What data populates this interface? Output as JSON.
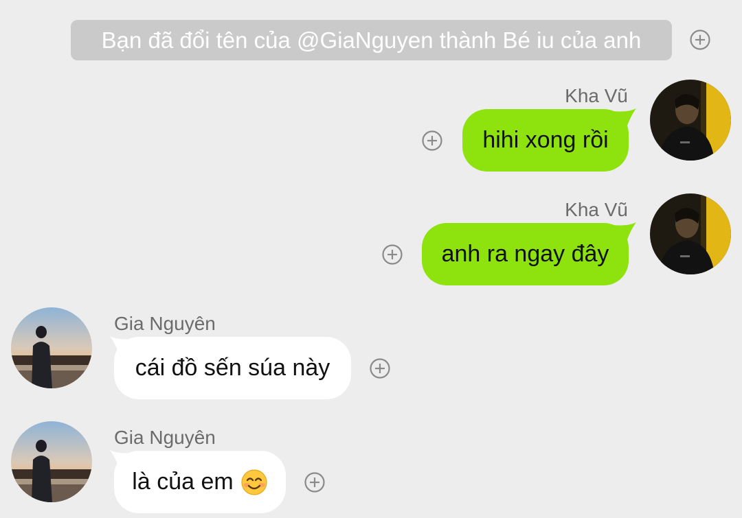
{
  "system_notice": "Bạn đã đổi tên của @GiaNguyen thành Bé iu của anh",
  "messages": [
    {
      "sender": "Kha Vũ",
      "text": "hihi xong rồi",
      "direction": "outgoing"
    },
    {
      "sender": "Kha Vũ",
      "text": "anh ra ngay đây",
      "direction": "outgoing"
    },
    {
      "sender": "Gia Nguyên",
      "text": "cái đồ sến súa này",
      "direction": "incoming"
    },
    {
      "sender": "Gia Nguyên",
      "text": "là của em",
      "emoji": "smiling-face-emoji",
      "direction": "incoming"
    }
  ],
  "colors": {
    "background": "#ededed",
    "sent_bubble": "#8ee30f",
    "received_bubble": "#ffffff",
    "notice_bg": "#cacaca",
    "sender_text": "#6b6b6b"
  },
  "icons": {
    "reaction": "add-circle-icon",
    "avatar_sent": "avatar-kha-vu",
    "avatar_recv": "avatar-gia-nguyen"
  }
}
